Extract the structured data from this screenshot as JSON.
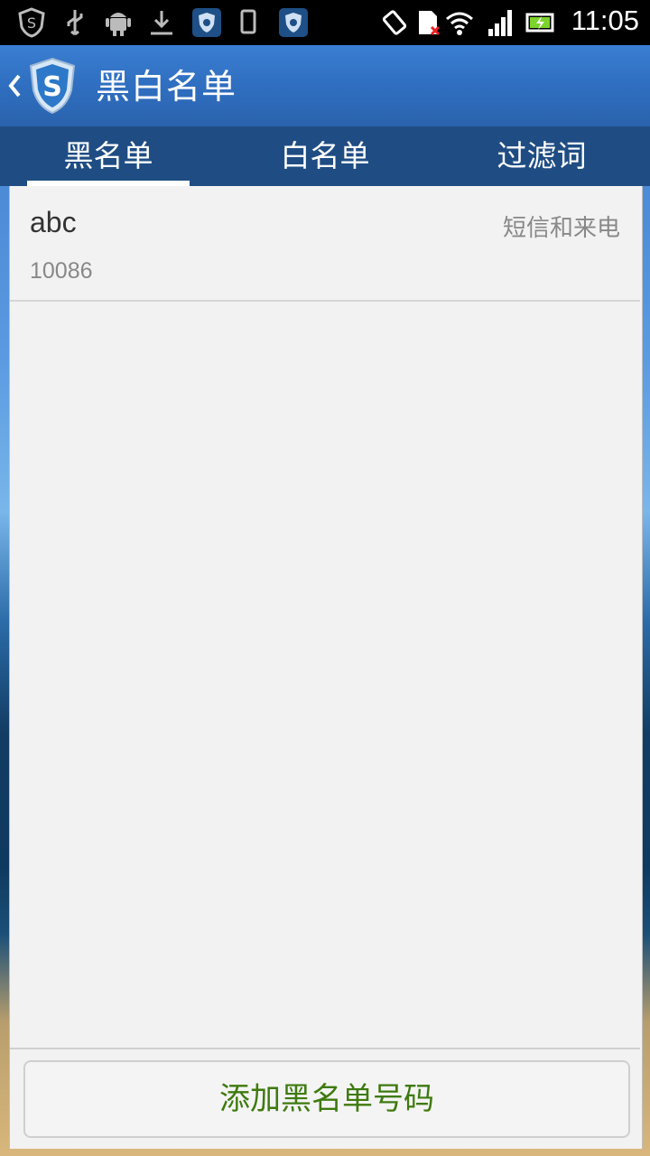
{
  "status_bar": {
    "time": "11:05",
    "icons": [
      "shield-s-icon",
      "usb-icon",
      "android-icon",
      "download-icon",
      "guard-icon",
      "phone-icon",
      "guard-icon",
      "rotate-icon",
      "sim-off-icon",
      "wifi-icon",
      "signal-icon",
      "battery-charging-icon"
    ]
  },
  "header": {
    "title": "黑白名单",
    "logo": "shield-s-logo"
  },
  "tabs": [
    {
      "label": "黑名单",
      "active": true
    },
    {
      "label": "白名单",
      "active": false
    },
    {
      "label": "过滤词",
      "active": false
    }
  ],
  "list": {
    "items": [
      {
        "name": "abc",
        "number": "10086",
        "block_type": "短信和来电"
      }
    ]
  },
  "footer": {
    "add_button_label": "添加黑名单号码"
  },
  "colors": {
    "action_bar": "#2f6ec0",
    "tab_bar": "#1f4d83",
    "panel": "#f2f2f2",
    "button_text": "#3e7a0f"
  }
}
